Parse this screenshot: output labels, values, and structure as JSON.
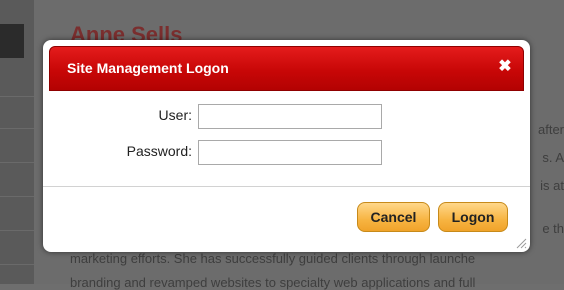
{
  "background": {
    "heading": "Anne Sells",
    "text_line_1": "marketing efforts. She has successfully guided clients through launche",
    "text_line_2": "branding and revamped websites to specialty web applications and full",
    "edge_fragments": [
      "after",
      "s. A",
      "is at",
      "e th"
    ]
  },
  "dialog": {
    "title": "Site Management Logon",
    "close_symbol": "✖",
    "user_label": "User:",
    "user_value": "",
    "password_label": "Password:",
    "password_value": "",
    "cancel_label": "Cancel",
    "logon_label": "Logon"
  },
  "colors": {
    "titlebar": "#c80707",
    "button": "#f7b442",
    "overlay": "#6e6e6e"
  },
  "icons": {
    "close": "close-icon",
    "resize": "resize-grip-icon"
  }
}
